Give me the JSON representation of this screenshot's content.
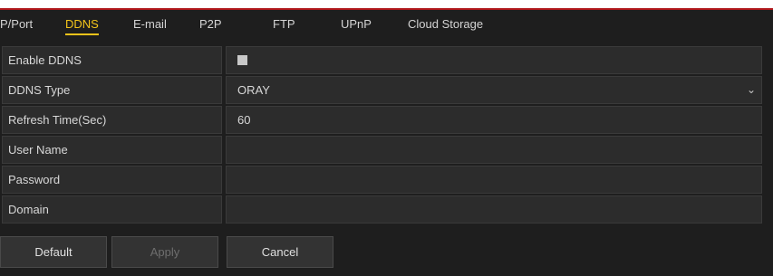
{
  "tabs": [
    {
      "label": "P/Port",
      "active": false
    },
    {
      "label": "DDNS",
      "active": true
    },
    {
      "label": "E-mail",
      "active": false
    },
    {
      "label": "P2P",
      "active": false
    },
    {
      "label": "FTP",
      "active": false
    },
    {
      "label": "UPnP",
      "active": false
    },
    {
      "label": "Cloud Storage",
      "active": false
    }
  ],
  "form": {
    "enable_ddns": {
      "label": "Enable DDNS",
      "checked": false
    },
    "ddns_type": {
      "label": "DDNS Type",
      "value": "ORAY"
    },
    "refresh_time": {
      "label": "Refresh Time(Sec)",
      "value": "60"
    },
    "user_name": {
      "label": "User Name",
      "value": ""
    },
    "password": {
      "label": "Password",
      "value": ""
    },
    "domain": {
      "label": "Domain",
      "value": ""
    }
  },
  "buttons": {
    "default_label": "Default",
    "apply_label": "Apply",
    "cancel_label": "Cancel"
  },
  "colors": {
    "accent": "#f3c41a",
    "panel_bg": "#1e1e1e",
    "top_line": "#b0171b"
  }
}
